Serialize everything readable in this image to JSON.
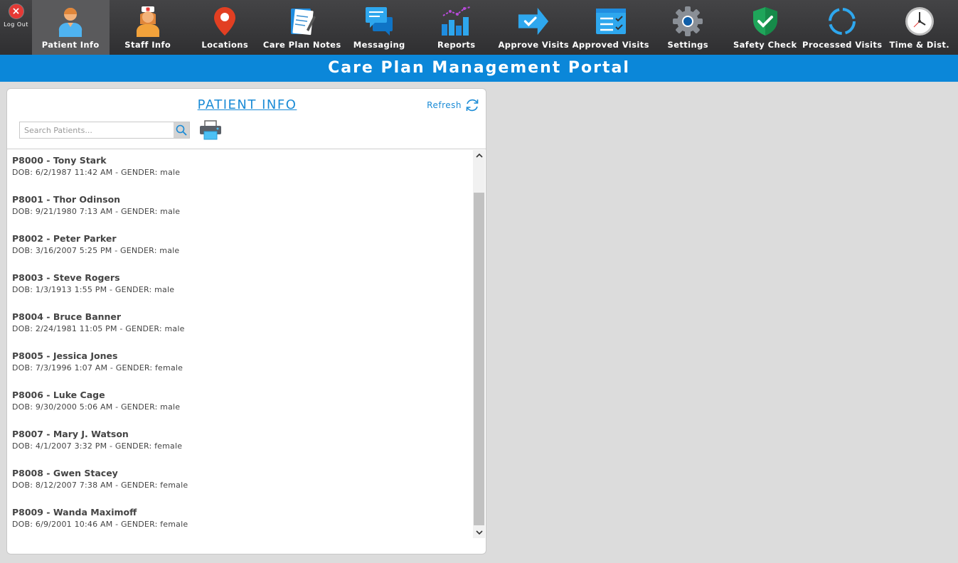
{
  "logout": {
    "label": "Log Out"
  },
  "nav": [
    {
      "label": "Patient Info",
      "icon": "patient-icon",
      "active": true
    },
    {
      "label": "Staff Info",
      "icon": "nurse-icon"
    },
    {
      "label": "Locations",
      "icon": "location-pin-icon"
    },
    {
      "label": "Care Plan Notes",
      "icon": "notes-icon"
    },
    {
      "label": "Messaging",
      "icon": "chat-bubbles-icon"
    },
    {
      "label": "Reports",
      "icon": "bar-chart-icon"
    },
    {
      "label": "Approve Visits",
      "icon": "arrow-check-icon"
    },
    {
      "label": "Approved Visits",
      "icon": "checklist-icon"
    },
    {
      "label": "Settings",
      "icon": "gear-icon"
    },
    {
      "label": "Safety Check",
      "icon": "shield-check-icon"
    },
    {
      "label": "Processed Visits",
      "icon": "refresh-circle-icon"
    },
    {
      "label": "Time & Dist.",
      "icon": "clock-icon"
    }
  ],
  "banner": {
    "title": "Care Plan Management Portal"
  },
  "panel": {
    "title": "PATIENT INFO",
    "refresh_label": "Refresh",
    "search_placeholder": "Search Patients...",
    "patients": [
      {
        "name": "P8000 - Tony Stark",
        "meta": "DOB: 6/2/1987 11:42 AM - GENDER: male"
      },
      {
        "name": "P8001 - Thor Odinson",
        "meta": "DOB: 9/21/1980 7:13 AM - GENDER: male"
      },
      {
        "name": "P8002 - Peter Parker",
        "meta": "DOB: 3/16/2007 5:25 PM - GENDER: male"
      },
      {
        "name": "P8003 - Steve Rogers",
        "meta": "DOB: 1/3/1913 1:55 PM - GENDER: male"
      },
      {
        "name": "P8004 - Bruce Banner",
        "meta": "DOB: 2/24/1981 11:05 PM - GENDER: male"
      },
      {
        "name": "P8005 - Jessica Jones",
        "meta": "DOB: 7/3/1996 1:07 AM - GENDER: female"
      },
      {
        "name": "P8006 - Luke Cage",
        "meta": "DOB: 9/30/2000 5:06 AM - GENDER: male"
      },
      {
        "name": "P8007 - Mary J. Watson",
        "meta": "DOB: 4/1/2007 3:32 PM - GENDER: female"
      },
      {
        "name": "P8008 - Gwen Stacey",
        "meta": "DOB: 8/12/2007 7:38 AM - GENDER: female"
      },
      {
        "name": "P8009 - Wanda Maximoff",
        "meta": "DOB: 6/9/2001 10:46 AM - GENDER: female"
      }
    ]
  },
  "colors": {
    "toolbar": "#38383a",
    "accent": "#0b87d9",
    "link": "#1a8bd6"
  }
}
